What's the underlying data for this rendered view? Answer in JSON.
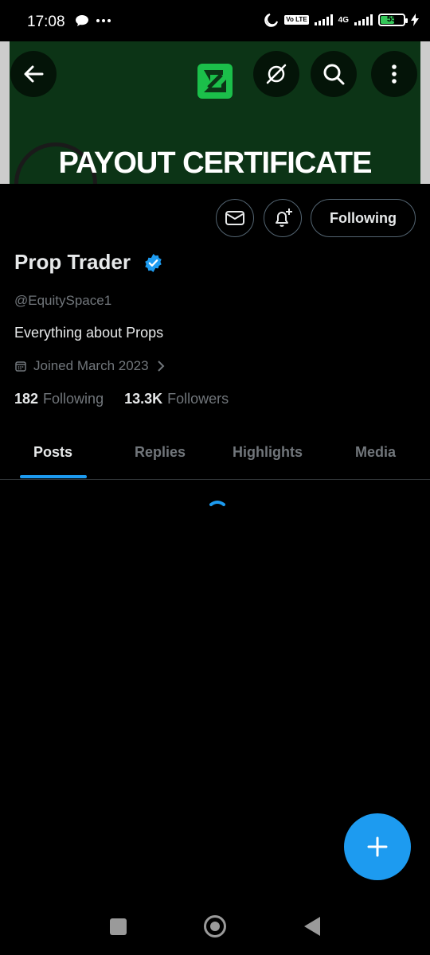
{
  "status_bar": {
    "time": "17:08",
    "volte_label": "Vo LTE",
    "network_label": "4G",
    "battery_level": "55",
    "icons": [
      "chat-bubble-icon",
      "more-dots-icon",
      "moon-icon",
      "signal-icon",
      "signal-icon",
      "battery-icon",
      "charging-icon"
    ]
  },
  "banner": {
    "title": "PAYOUT CERTIFICATE",
    "background_color": "#0c3416",
    "logo_color": "#1bbf4a"
  },
  "header_buttons": {
    "back_icon": "back-arrow-icon",
    "grok_icon": "grok-icon",
    "search_icon": "search-icon",
    "more_icon": "more-vertical-icon"
  },
  "actions": {
    "message_icon": "mail-icon",
    "notify_icon": "bell-plus-icon",
    "following_label": "Following"
  },
  "profile": {
    "name": "Prop Trader",
    "handle": "@EquitySpace1",
    "bio": "Everything about Props",
    "joined": "Joined March 2023",
    "following_count": "182",
    "following_label": "Following",
    "followers_count": "13.3K",
    "followers_label": "Followers",
    "verified_color": "#1d9bf0"
  },
  "tabs": [
    {
      "label": "Posts",
      "active": true
    },
    {
      "label": "Replies",
      "active": false
    },
    {
      "label": "Highlights",
      "active": false
    },
    {
      "label": "Media",
      "active": false
    }
  ],
  "accent_color": "#1d9bf0",
  "fab": {
    "icon": "plus-icon"
  },
  "nav_bar": {
    "icons": [
      "recents-square-icon",
      "home-circle-icon",
      "back-triangle-icon"
    ]
  }
}
